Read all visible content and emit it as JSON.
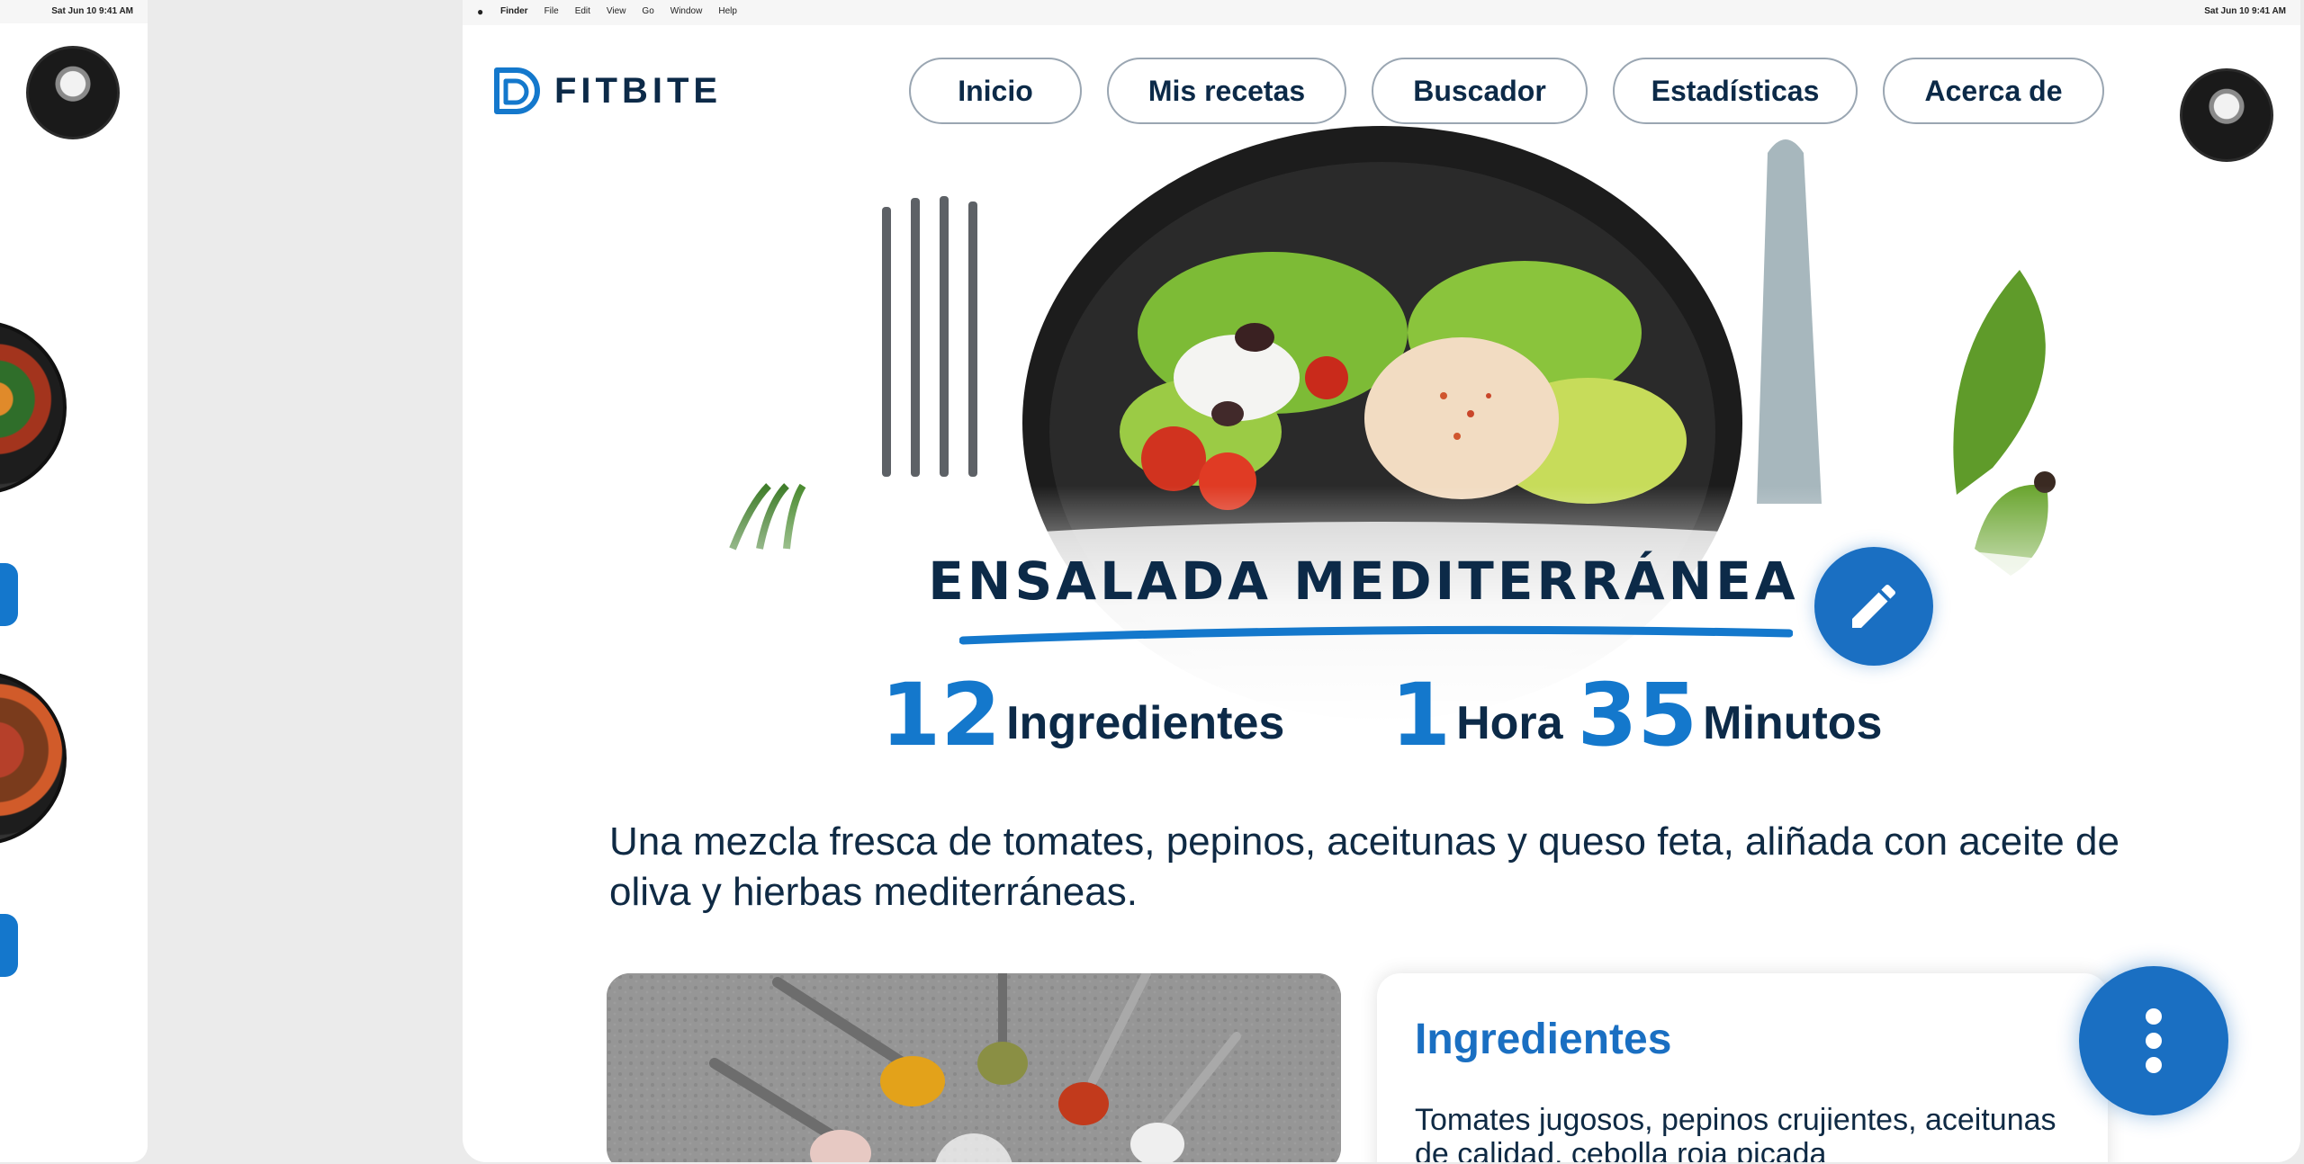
{
  "os_menubar": {
    "clock": "Sat Jun 10  9:41 AM",
    "apple_icon": "apple-icon",
    "menus": [
      "Finder",
      "File",
      "Edit",
      "View",
      "Go",
      "Window",
      "Help"
    ]
  },
  "app": {
    "brand": "FITBITE",
    "logo_icon": "fitbite-logo-icon",
    "accent_color": "#1478cc",
    "dark_color": "#0c2a48"
  },
  "nav": {
    "inicio": "Inicio",
    "recetas": "Mis recetas",
    "buscador": "Buscador",
    "estadisticas": "Estadísticas",
    "acerca": "Acerca de"
  },
  "recipe": {
    "title": "ENSALADA MEDITERRÁNEA",
    "ingredients_count": "12",
    "ingredients_label": "Ingredientes",
    "hours": "1",
    "hours_label": "Hora",
    "minutes": "35",
    "minutes_label": "Minutos",
    "description": "Una mezcla fresca de tomates, pepinos, aceitunas y queso feta, aliñada con aceite de oliva y hierbas mediterráneas.",
    "edit_icon": "pencil-icon"
  },
  "ingredients_card": {
    "title": "Ingredientes",
    "text": "Tomates jugosos, pepinos crujientes, aceitunas de calidad, cebolla roja picada"
  },
  "fab": {
    "icon": "more-vertical-icon"
  }
}
